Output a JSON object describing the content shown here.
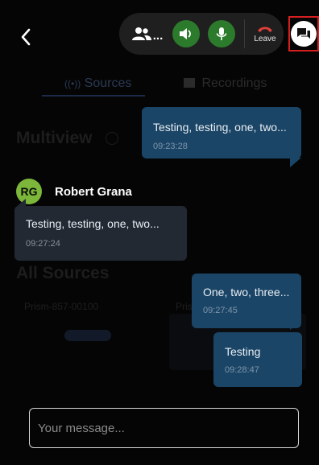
{
  "background": {
    "tabs": {
      "sources": "Sources",
      "recordings": "Recordings"
    },
    "multiview_heading": "Multiview",
    "all_sources_heading": "All Sources",
    "source_names": [
      "Prism-857-00100",
      "Prism"
    ]
  },
  "call_controls": {
    "participants_label": "...",
    "leave_label": "Leave"
  },
  "messages": [
    {
      "direction": "outgoing",
      "text": "Testing, testing, one, two...",
      "time": "09:23:28"
    },
    {
      "direction": "incoming",
      "sender": "Robert Grana",
      "avatar_initials": "RG",
      "text": "Testing, testing, one, two...",
      "time": "09:27:24"
    },
    {
      "direction": "outgoing",
      "text": "One, two, three...",
      "time": "09:27:45"
    },
    {
      "direction": "outgoing",
      "text": "Testing",
      "time": "09:28:47"
    }
  ],
  "composer": {
    "placeholder": "Your message...",
    "value": ""
  },
  "colors": {
    "outgoing_bubble": "#1a4566",
    "incoming_bubble": "#232933",
    "avatar": "#7cb63a",
    "active_control": "#2c7a2c",
    "leave": "#e0403b",
    "highlight": "#d61f1f"
  },
  "icons": {
    "back": "chevron-left-icon",
    "participants": "people-icon",
    "speaker": "speaker-icon",
    "mic": "microphone-icon",
    "leave": "phone-hangup-icon",
    "chat": "chat-icon"
  }
}
